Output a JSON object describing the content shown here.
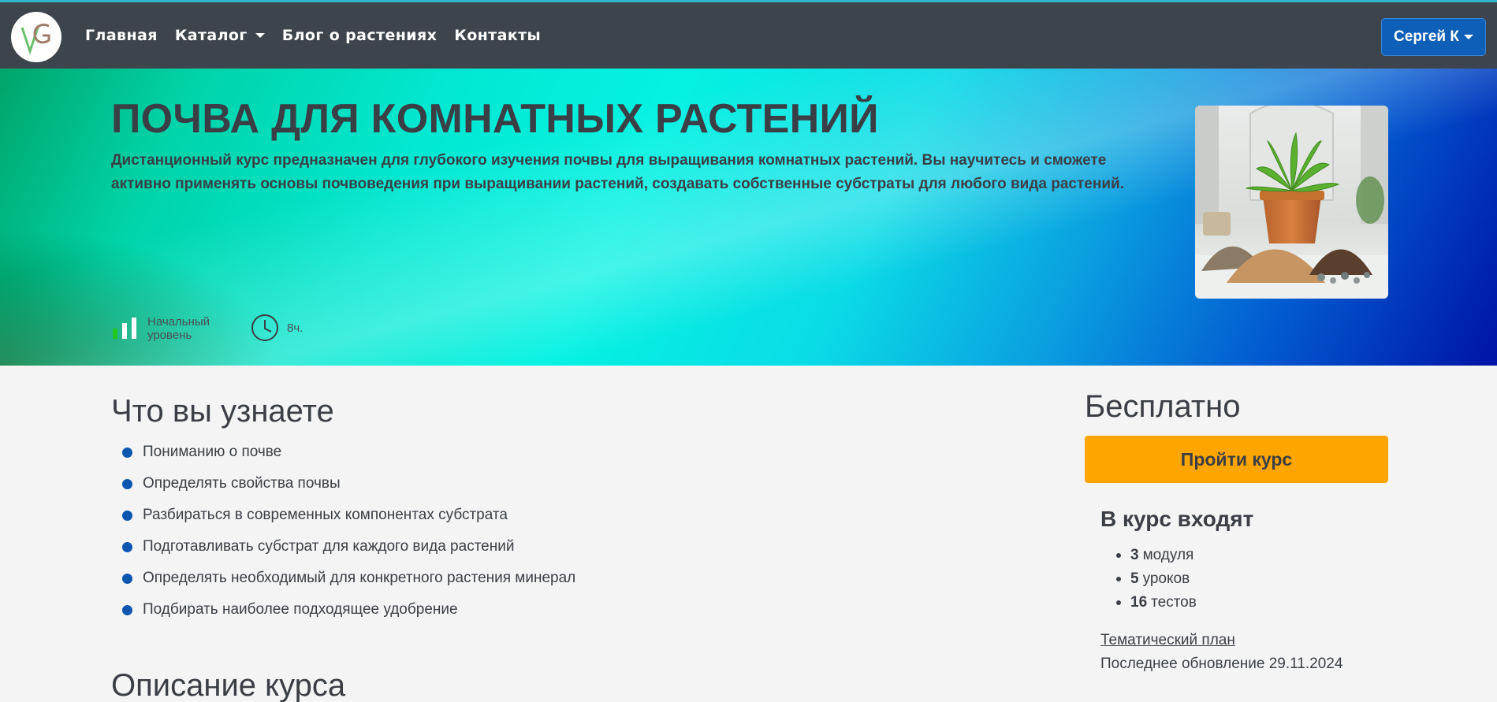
{
  "nav": {
    "logo_letters": "VG",
    "items": [
      {
        "label": "Главная"
      },
      {
        "label": "Каталог",
        "dropdown": true
      },
      {
        "label": "Блог о растениях"
      },
      {
        "label": "Контакты"
      }
    ],
    "user_label": "Сергей К"
  },
  "hero": {
    "title": "ПОЧВА ДЛЯ КОМНАТНЫХ РАСТЕНИЙ",
    "description": "Дистанционный курс предназначен для глубокого изучения почвы для выращивания комнатных растений. Вы научитесь и сможете активно применять основы почвоведения при выращивании растений, создавать собственные субстраты для любого вида растений.",
    "level_line1": "Начальный",
    "level_line2": "уровень",
    "level_icon": "signal-bars-icon",
    "duration": "8ч.",
    "duration_icon": "clock-icon",
    "image": "plant-pot-soil-image"
  },
  "learn": {
    "title": "Что вы узнаете",
    "items": [
      "Пониманию о почве",
      "Определять свойства почвы",
      "Разбираться в современных компонентах субстрата",
      "Подготавливать субстрат для каждого вида растений",
      "Определять необходимый для конкретного растения минерал",
      "Подбирать наиболее подходящее удобрение"
    ]
  },
  "description": {
    "title": "Описание курса"
  },
  "card": {
    "price": "Бесплатно",
    "cta_label": "Пройти курс",
    "includes_title": "В курс входят",
    "includes": [
      {
        "count": "3",
        "label": "модуля"
      },
      {
        "count": "5",
        "label": "уроков"
      },
      {
        "count": "16",
        "label": "тестов"
      }
    ],
    "plan_link": "Тематический план",
    "updated": "Последнее обновление 29.11.2024"
  },
  "colors": {
    "navbar": "#3e444c",
    "accent_blue": "#0d5fb8",
    "cta": "#ffa500",
    "level_green": "#20c91f"
  }
}
